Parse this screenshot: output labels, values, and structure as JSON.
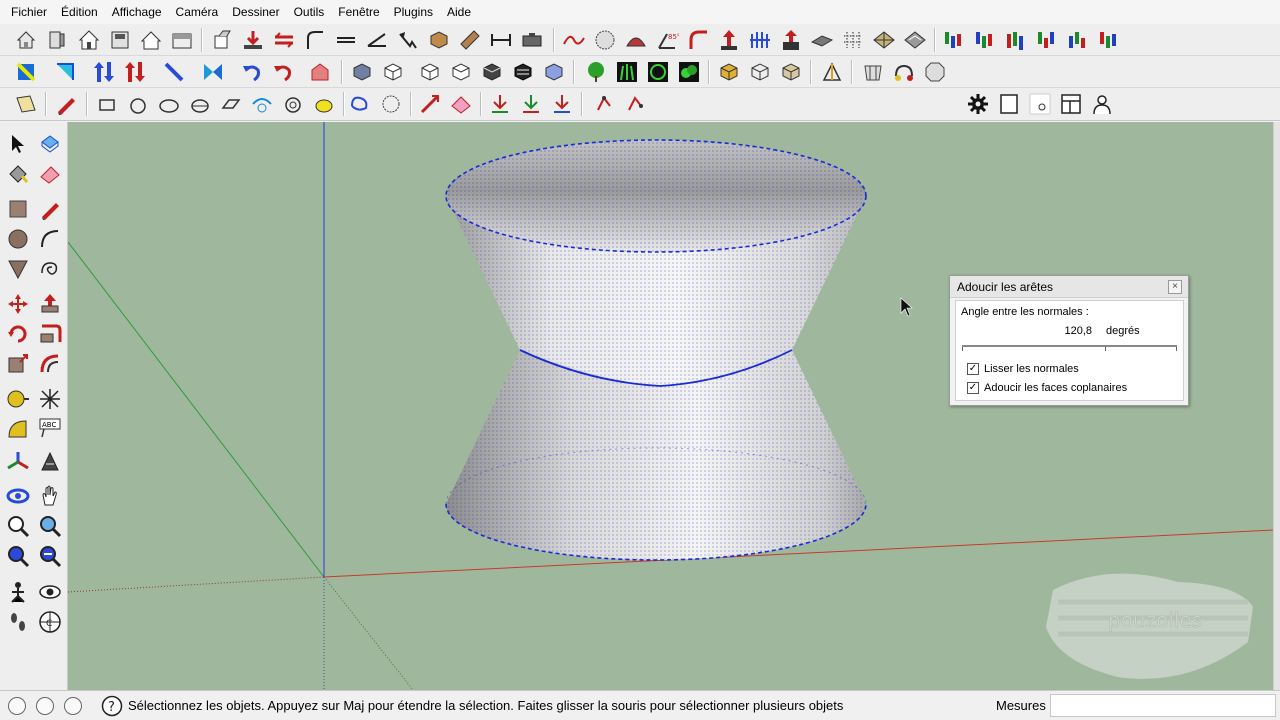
{
  "menu": [
    "Fichier",
    "Édition",
    "Affichage",
    "Caméra",
    "Dessiner",
    "Outils",
    "Fenêtre",
    "Plugins",
    "Aide"
  ],
  "dialog": {
    "title": "Adoucir les arêtes",
    "angle_label": "Angle entre les normales :",
    "angle_value": "120,8",
    "angle_unit": "degrés",
    "angle_slider_fraction": 0.67,
    "checkbox1_label": "Lisser les normales",
    "checkbox1_checked": true,
    "checkbox2_label": "Adoucir les faces coplanaires",
    "checkbox2_checked": true,
    "close_glyph": "×"
  },
  "status": {
    "text": "Sélectionnez les objets. Appuyez sur Maj pour étendre la sélection. Faites glisser la souris pour sélectionner plusieurs objets",
    "measures_label": "Mesures",
    "measures_value": ""
  },
  "watermark": "pouzolles",
  "colors": {
    "viewport_bg": "#9fb89d",
    "selection_blue": "#1a2bd6",
    "axis_red": "#c83a2a",
    "axis_green": "#2f9a3a",
    "axis_blue": "#2540d8"
  },
  "icons": {
    "toolbar_row1": [
      "new-icon",
      "open-icon",
      "save-icon",
      "cut-icon",
      "copy-icon",
      "paste-icon",
      "push-pull-icon",
      "move-icon",
      "follow-me-icon"
    ],
    "toolbar_row2": [
      "select-icon",
      "rotate-icon",
      "views-icon",
      "styles-icon",
      "shadows-icon"
    ],
    "toolbar_row3": [
      "sandbox-icon",
      "section-icon",
      "settings-gear-icon",
      "page-icon",
      "layout-icon",
      "user-icon"
    ],
    "left_tools": [
      "select-arrow-icon",
      "component-icon",
      "paint-bucket-icon",
      "eraser-icon",
      "rectangle-icon",
      "pencil-icon",
      "circle-icon",
      "arc-icon",
      "polygon-icon",
      "freehand-icon",
      "move-tool-icon",
      "push-pull-tool-icon",
      "rotate-tool-icon",
      "follow-me-tool-icon",
      "scale-tool-icon",
      "offset-tool-icon",
      "tape-measure-icon",
      "dimension-icon",
      "protractor-icon",
      "text-icon",
      "axes-icon",
      "3d-text-icon",
      "orbit-icon",
      "pan-icon",
      "zoom-icon",
      "zoom-window-icon",
      "zoom-extents-icon",
      "previous-view-icon",
      "position-camera-icon",
      "look-around-icon",
      "walk-icon",
      "section-plane-icon"
    ]
  }
}
